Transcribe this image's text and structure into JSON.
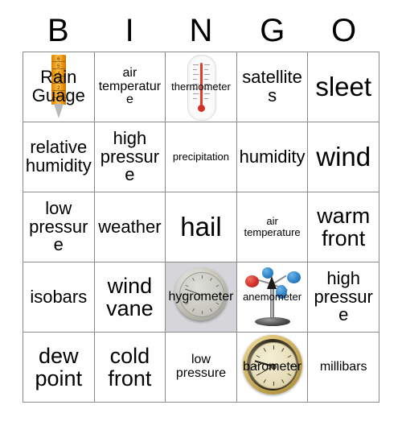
{
  "card": {
    "title_letters": [
      "B",
      "I",
      "N",
      "G",
      "O"
    ],
    "rows": [
      [
        {
          "label": "Rain Guage",
          "art": "rain-gauge",
          "size": "fs-md"
        },
        {
          "label": "air temperature",
          "art": "none",
          "size": "fs-sm"
        },
        {
          "label": "thermometer",
          "art": "thermometer",
          "size": "fs-xs"
        },
        {
          "label": "satellites",
          "art": "none",
          "size": "fs-md"
        },
        {
          "label": "sleet",
          "art": "none",
          "size": "fs-xl"
        }
      ],
      [
        {
          "label": "relative humidity",
          "art": "none",
          "size": "fs-md"
        },
        {
          "label": "high pressure",
          "art": "none",
          "size": "fs-md"
        },
        {
          "label": "precipitation",
          "art": "none",
          "size": "fs-xs"
        },
        {
          "label": "humidity",
          "art": "none",
          "size": "fs-md"
        },
        {
          "label": "wind",
          "art": "none",
          "size": "fs-xl"
        }
      ],
      [
        {
          "label": "low pressure",
          "art": "none",
          "size": "fs-md"
        },
        {
          "label": "weather",
          "art": "none",
          "size": "fs-md"
        },
        {
          "label": "hail",
          "art": "none",
          "size": "fs-xl"
        },
        {
          "label": "air temperature",
          "art": "none",
          "size": "fs-xs"
        },
        {
          "label": "warm front",
          "art": "none",
          "size": "fs-lg"
        }
      ],
      [
        {
          "label": "isobars",
          "art": "none",
          "size": "fs-md"
        },
        {
          "label": "wind vane",
          "art": "none",
          "size": "fs-lg"
        },
        {
          "label": "hygrometer",
          "art": "hygrometer",
          "size": "fs-sm"
        },
        {
          "label": "anemometer",
          "art": "anemometer",
          "size": "fs-xs"
        },
        {
          "label": "high pressure",
          "art": "none",
          "size": "fs-md"
        }
      ],
      [
        {
          "label": "dew point",
          "art": "none",
          "size": "fs-lg"
        },
        {
          "label": "cold front",
          "art": "none",
          "size": "fs-lg"
        },
        {
          "label": "low pressure",
          "art": "none",
          "size": "fs-sm"
        },
        {
          "label": "barometer",
          "art": "barometer",
          "size": "fs-sm"
        },
        {
          "label": "millibars",
          "art": "none",
          "size": "fs-sm"
        }
      ]
    ],
    "rain_gauge_scale": [
      "6",
      "5",
      "4",
      "3",
      "2",
      "1"
    ],
    "colors": {
      "grid_border": "#8a8a8a",
      "text": "#000000",
      "background": "#ffffff",
      "rain_gauge": "#f29d12",
      "thermometer_mercury": "#e23b2e",
      "anemometer_cup_blue": "#2f82c9",
      "anemometer_cup_red": "#d3302a",
      "barometer_brass": "#d4b865",
      "hygrometer_silver": "#c2c2b8",
      "image_cell_background": "#d6d6da"
    }
  }
}
